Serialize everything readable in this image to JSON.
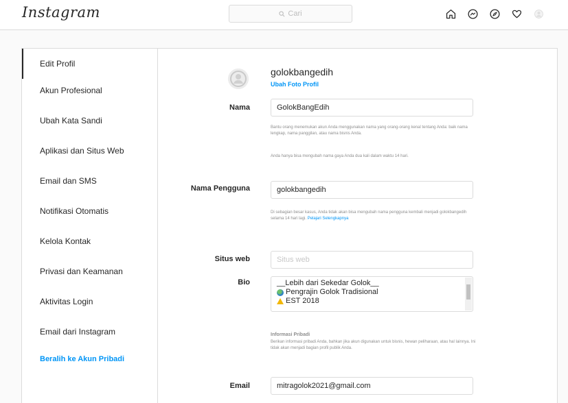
{
  "header": {
    "logo": "Instagram",
    "search_placeholder": "Cari",
    "icons": [
      "home-icon",
      "messenger-icon",
      "explore-icon",
      "heart-icon",
      "profile-icon"
    ]
  },
  "sidebar": {
    "items": [
      {
        "label": "Edit Profil",
        "active": true
      },
      {
        "label": "Akun Profesional"
      },
      {
        "label": "Ubah Kata Sandi"
      },
      {
        "label": "Aplikasi dan Situs Web"
      },
      {
        "label": "Email dan SMS"
      },
      {
        "label": "Notifikasi Otomatis"
      },
      {
        "label": "Kelola Kontak"
      },
      {
        "label": "Privasi dan Keamanan"
      },
      {
        "label": "Aktivitas Login"
      },
      {
        "label": "Email dari Instagram"
      },
      {
        "label": "Beralih ke Akun Pribadi",
        "link": true
      }
    ]
  },
  "profile": {
    "username": "golokbangedih",
    "change_photo": "Ubah Foto Profil"
  },
  "form": {
    "name": {
      "label": "Nama",
      "value": "GolokBangEdih",
      "help1": "Bantu orang menemukan akun Anda menggunakan nama yang orang-orang kenal tentang Anda: baik nama lengkap, nama panggilan, atau nama bisnis Anda.",
      "help2": "Anda hanya bisa mengubah nama gaya Anda dua kali dalam waktu 14 hari."
    },
    "username": {
      "label": "Nama Pengguna",
      "value": "golokbangedih",
      "help": "Di sebagian besar kasus, Anda tidak akan bisa mengubah nama pengguna kembali menjadi golokbangedih selama 14 hari lagi.",
      "help_link": "Pelajari Selengkapnya"
    },
    "website": {
      "label": "Situs web",
      "placeholder": "Situs web"
    },
    "bio": {
      "label": "Bio",
      "lines": [
        "__Lebih dari Sekedar Golok__",
        "Pengrajin Golok Tradisional",
        "EST 2018"
      ]
    },
    "personal_info": {
      "title": "Informasi Pribadi",
      "help": "Berikan informasi pribadi Anda, bahkan jika akun digunakan untuk bisnis, hewan peliharaan, atau hal lainnya. Ini tidak akan menjadi bagian profil publik Anda."
    },
    "email": {
      "label": "Email",
      "value": "mitragolok2021@gmail.com"
    }
  },
  "colors": {
    "link": "#0095f6",
    "border": "#dbdbdb",
    "background": "#fafafa",
    "muted": "#8e8e8e"
  }
}
